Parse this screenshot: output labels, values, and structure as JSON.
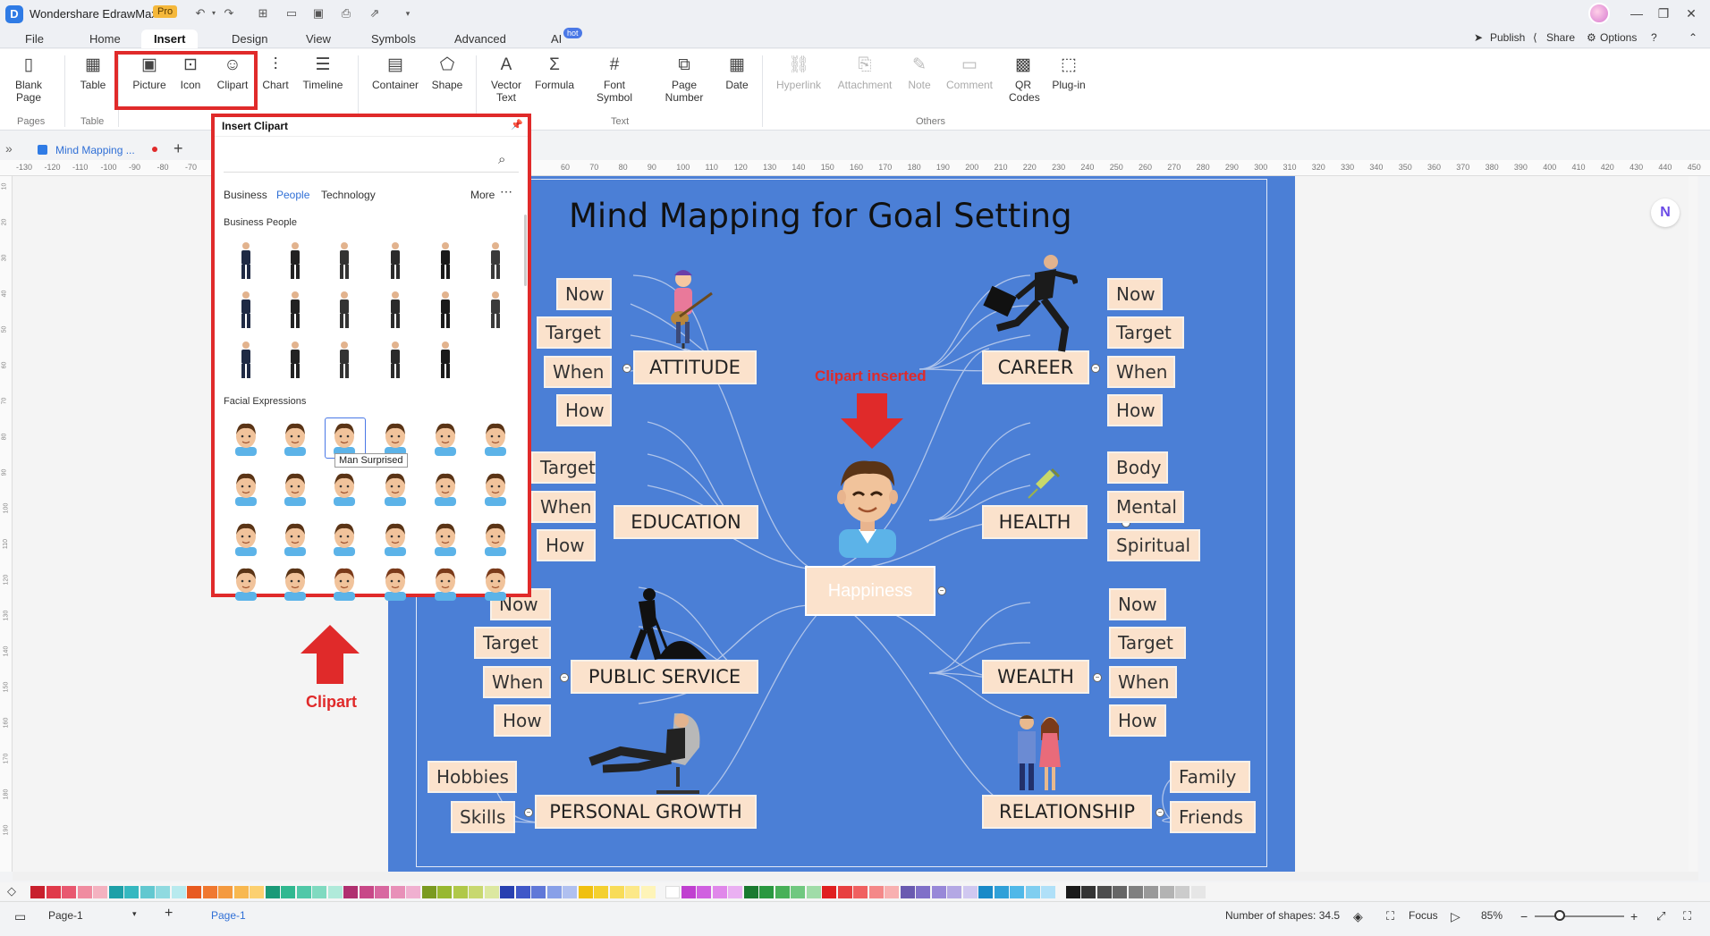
{
  "app": {
    "name": "Wondershare EdrawMax",
    "badge": "Pro"
  },
  "menu": {
    "tabs": [
      "File",
      "Home",
      "Insert",
      "Design",
      "View",
      "Symbols",
      "Advanced",
      "AI"
    ],
    "active": "Insert",
    "hot_badge": "hot",
    "publish": "Publish",
    "share": "Share",
    "options": "Options"
  },
  "ribbon": {
    "blank_page": "Blank\nPage",
    "table": "Table",
    "picture": "Picture",
    "icon": "Icon",
    "clipart": "Clipart",
    "chart": "Chart",
    "timeline": "Timeline",
    "container": "Container",
    "shape": "Shape",
    "vector_text": "Vector\nText",
    "formula": "Formula",
    "font_symbol": "Font\nSymbol",
    "page_number": "Page\nNumber",
    "date": "Date",
    "hyperlink": "Hyperlink",
    "attachment": "Attachment",
    "note": "Note",
    "comment": "Comment",
    "qr_codes": "QR\nCodes",
    "plugin": "Plug-in",
    "groups": {
      "pages": "Pages",
      "table": "Table",
      "text": "Text",
      "others": "Others"
    }
  },
  "document_tab": {
    "name": "Mind Mapping ..."
  },
  "ruler_labels": [
    "-130",
    "-120",
    "-110",
    "-100",
    "-90",
    "-80",
    "-70",
    "60",
    "70",
    "80",
    "90",
    "100",
    "110",
    "120",
    "130",
    "140",
    "150",
    "160",
    "170",
    "180",
    "190",
    "200",
    "210",
    "220",
    "230",
    "240",
    "250",
    "260",
    "270",
    "280",
    "290",
    "300",
    "310",
    "320",
    "330",
    "340",
    "350",
    "360",
    "370",
    "380",
    "390",
    "400",
    "410",
    "420",
    "430",
    "440",
    "450"
  ],
  "vruler_labels": [
    "10",
    "20",
    "30",
    "40",
    "50",
    "60",
    "70",
    "80",
    "90",
    "100",
    "110",
    "120",
    "130",
    "140",
    "150",
    "160",
    "170",
    "180",
    "190"
  ],
  "panel": {
    "title": "Insert Clipart",
    "categories": [
      "Business",
      "People",
      "Technology"
    ],
    "active_category": "People",
    "more": "More",
    "section_business": "Business People",
    "section_faces": "Facial Expressions",
    "tooltip": "Man Surprised"
  },
  "mindmap": {
    "title": "Mind Mapping for Goal Setting",
    "center": "Happiness",
    "nodes": {
      "attitude": "ATTITUDE",
      "career": "CAREER",
      "education": "EDUCATION",
      "health": "HEALTH",
      "public_service": "PUBLIC SERVICE",
      "wealth": "WEALTH",
      "personal_growth": "PERSONAL GROWTH",
      "relationship": "RELATIONSHIP"
    },
    "leaves": {
      "attitude": [
        "Now",
        "Target",
        "When",
        "How"
      ],
      "career": [
        "Now",
        "Target",
        "When",
        "How"
      ],
      "education": [
        "Target",
        "When",
        "How"
      ],
      "health": [
        "Body",
        "Mental",
        "Spiritual"
      ],
      "public_service": [
        "Now",
        "Target",
        "When",
        "How"
      ],
      "wealth": [
        "Now",
        "Target",
        "When",
        "How"
      ],
      "personal_growth": [
        "Hobbies",
        "Skills"
      ],
      "relationship": [
        "Family",
        "Friends"
      ]
    }
  },
  "annotations": {
    "clipart_inserted": "Clipart inserted",
    "clipart": "Clipart"
  },
  "palette": [
    "#c8202d",
    "#e03a4a",
    "#e85870",
    "#f08ca0",
    "#f4b2c0",
    "#1ea0a8",
    "#36b8c0",
    "#62c8d0",
    "#90dae0",
    "#b8eaee",
    "#e85a20",
    "#f07830",
    "#f49a40",
    "#f8b850",
    "#fcd070",
    "#1a9a78",
    "#30b890",
    "#50c8a8",
    "#80dac0",
    "#b0eada",
    "#b03070",
    "#c84888",
    "#d868a0",
    "#e890b8",
    "#f0b0d0",
    "#7a9a20",
    "#98b830",
    "#b0c848",
    "#c8d870",
    "#dce8a0",
    "#2840b0",
    "#4058c8",
    "#6078d8",
    "#88a0e8",
    "#b0c0f0",
    "#f0c010",
    "#f4d030",
    "#f8dc58",
    "#fce888",
    "#fef4b8",
    "#ffffff",
    "#c040d0",
    "#d060e0",
    "#e088ea",
    "#eab0f2",
    "#1a7a30",
    "#2a9840",
    "#48b058",
    "#70c880",
    "#a0dca8",
    "#e02020",
    "#e84040",
    "#f06060",
    "#f48888",
    "#f8b0b0",
    "#6a5ab0",
    "#8070c8",
    "#9888d8",
    "#b4a8e4",
    "#d0c8f0",
    "#1a8ac8",
    "#30a0d8",
    "#50b8e8",
    "#80cef0",
    "#b0e0f8",
    "#1a1a1a",
    "#333333",
    "#4d4d4d",
    "#666666",
    "#808080",
    "#999999",
    "#b3b3b3",
    "#cccccc",
    "#e6e6e6"
  ],
  "status": {
    "page_selector": "Page-1",
    "page_tab": "Page-1",
    "shapes": "Number of shapes: 34.5",
    "focus": "Focus",
    "zoom": "85%"
  }
}
